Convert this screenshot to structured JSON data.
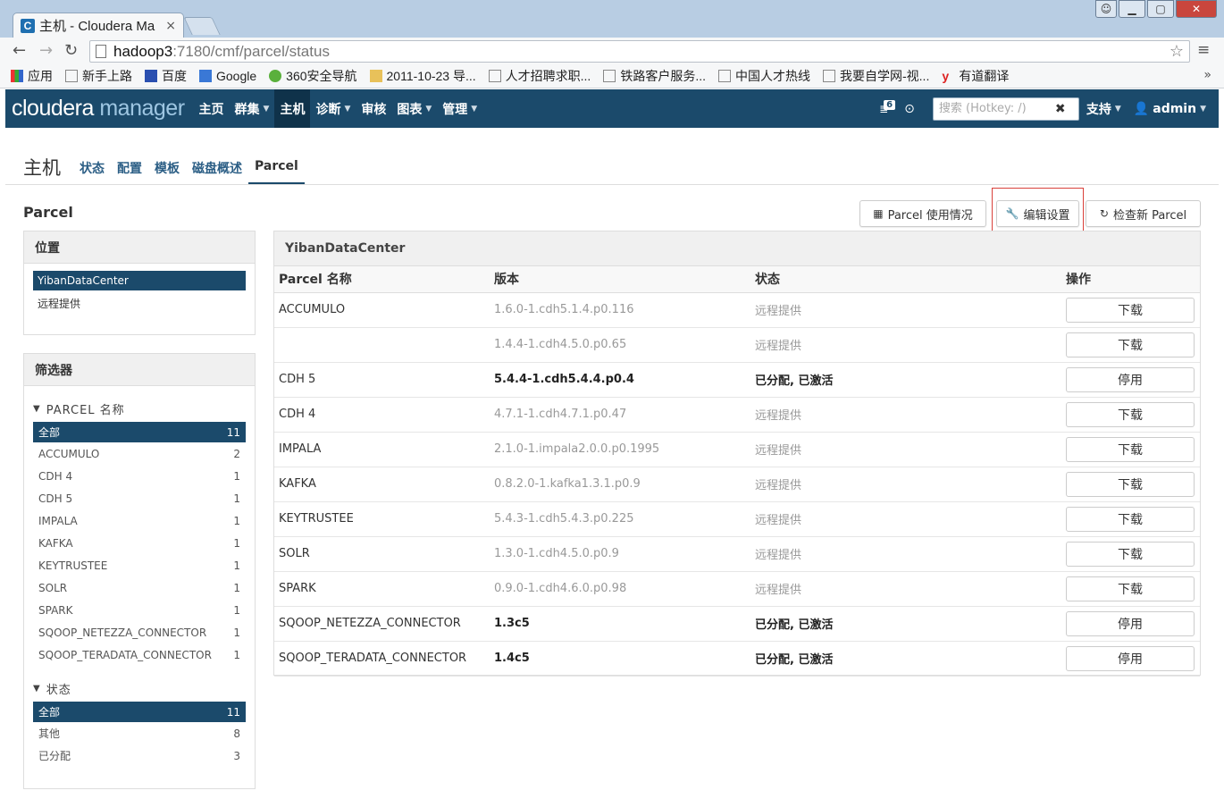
{
  "browser": {
    "tab_title": "主机 - Cloudera Ma",
    "url_host": "hadoop3",
    "url_path": ":7180/cmf/parcel/status",
    "bookmarks": [
      "应用",
      "新手上路",
      "百度",
      "Google",
      "360安全导航",
      "2011-10-23 导...",
      "人才招聘求职...",
      "铁路客户服务...",
      "中国人才热线",
      "我要自学网-视...",
      "有道翻译"
    ],
    "more": "»"
  },
  "header": {
    "logo_a": "cloudera",
    "logo_b": "manager",
    "nav": [
      "主页",
      "群集",
      "主机",
      "诊断",
      "审核",
      "图表",
      "管理"
    ],
    "badge_count": "6",
    "search_placeholder": "搜索 (Hotkey: /)",
    "support": "支持",
    "user": "admin"
  },
  "page": {
    "title": "主机",
    "subtabs": [
      "状态",
      "配置",
      "模板",
      "磁盘概述",
      "Parcel"
    ]
  },
  "section": {
    "title": "Parcel",
    "buttons": {
      "usage": "Parcel 使用情况",
      "edit": "编辑设置",
      "check": "检查新 Parcel"
    }
  },
  "location": {
    "head": "位置",
    "items": [
      "YibanDataCenter",
      "远程提供"
    ]
  },
  "filters": {
    "head": "筛选器",
    "group1": "PARCEL 名称",
    "names": [
      {
        "label": "全部",
        "count": "11"
      },
      {
        "label": "ACCUMULO",
        "count": "2"
      },
      {
        "label": "CDH 4",
        "count": "1"
      },
      {
        "label": "CDH 5",
        "count": "1"
      },
      {
        "label": "IMPALA",
        "count": "1"
      },
      {
        "label": "KAFKA",
        "count": "1"
      },
      {
        "label": "KEYTRUSTEE",
        "count": "1"
      },
      {
        "label": "SOLR",
        "count": "1"
      },
      {
        "label": "SPARK",
        "count": "1"
      },
      {
        "label": "SQOOP_NETEZZA_CONNECTOR",
        "count": "1"
      },
      {
        "label": "SQOOP_TERADATA_CONNECTOR",
        "count": "1"
      }
    ],
    "group2": "状态",
    "states": [
      {
        "label": "全部",
        "count": "11"
      },
      {
        "label": "其他",
        "count": "8"
      },
      {
        "label": "已分配",
        "count": "3"
      }
    ]
  },
  "table": {
    "panel_title": "YibanDataCenter",
    "columns": [
      "Parcel 名称",
      "版本",
      "状态",
      "操作"
    ],
    "rows": [
      {
        "name": "ACCUMULO",
        "version": "1.6.0-1.cdh5.1.4.p0.116",
        "status": "远程提供",
        "action": "下载"
      },
      {
        "name": "",
        "version": "1.4.4-1.cdh4.5.0.p0.65",
        "status": "远程提供",
        "action": "下载"
      },
      {
        "name": "CDH 5",
        "version": "5.4.4-1.cdh5.4.4.p0.4",
        "status": "已分配, 已激活",
        "action": "停用"
      },
      {
        "name": "CDH 4",
        "version": "4.7.1-1.cdh4.7.1.p0.47",
        "status": "远程提供",
        "action": "下载"
      },
      {
        "name": "IMPALA",
        "version": "2.1.0-1.impala2.0.0.p0.1995",
        "status": "远程提供",
        "action": "下载"
      },
      {
        "name": "KAFKA",
        "version": "0.8.2.0-1.kafka1.3.1.p0.9",
        "status": "远程提供",
        "action": "下载"
      },
      {
        "name": "KEYTRUSTEE",
        "version": "5.4.3-1.cdh5.4.3.p0.225",
        "status": "远程提供",
        "action": "下载"
      },
      {
        "name": "SOLR",
        "version": "1.3.0-1.cdh4.5.0.p0.9",
        "status": "远程提供",
        "action": "下载"
      },
      {
        "name": "SPARK",
        "version": "0.9.0-1.cdh4.6.0.p0.98",
        "status": "远程提供",
        "action": "下载"
      },
      {
        "name": "SQOOP_NETEZZA_CONNECTOR",
        "version": "1.3c5",
        "status": "已分配, 已激活",
        "action": "停用"
      },
      {
        "name": "SQOOP_TERADATA_CONNECTOR",
        "version": "1.4c5",
        "status": "已分配, 已激活",
        "action": "停用"
      }
    ]
  },
  "colors": {
    "header_bg": "#1b4a6b",
    "selected_bg": "#1b4a6b",
    "highlight_border": "#d9403a"
  }
}
